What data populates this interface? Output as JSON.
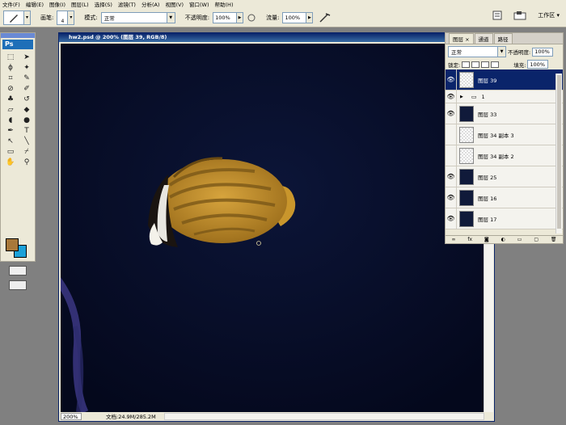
{
  "menubar": {
    "items": [
      "文件(F)",
      "编辑(E)",
      "图像(I)",
      "图层(L)",
      "选择(S)",
      "滤镜(T)",
      "分析(A)",
      "视图(V)",
      "窗口(W)",
      "帮助(H)"
    ]
  },
  "options": {
    "brush_label": "画笔:",
    "brush_size": "4",
    "mode_label": "模式:",
    "mode_value": "正常",
    "opacity_label": "不透明度:",
    "opacity_value": "100%",
    "flow_label": "流量:",
    "flow_value": "100%",
    "workspace": "工作区 ▾"
  },
  "toolbox": {
    "logo": "Ps"
  },
  "document": {
    "title": "hw2.psd @ 200% (图层 39, RGB/8)",
    "zoom": "200%",
    "doc_info": "文档:24.9M/285.2M"
  },
  "layers_panel": {
    "tabs": [
      "图层 ×",
      "通道",
      "路径"
    ],
    "blend_mode": "正常",
    "opacity_label": "不透明度:",
    "opacity_value": "100%",
    "lock_label": "锁定:",
    "fill_label": "填充:",
    "fill_value": "100%",
    "layers": [
      {
        "name": "图层 39",
        "visible": true,
        "selected": true,
        "thumb": "t"
      },
      {
        "name": "1",
        "visible": true,
        "group": true
      },
      {
        "name": "图层 33",
        "visible": true,
        "thumb": "d"
      },
      {
        "name": "图层 34 副本 3",
        "visible": false,
        "thumb": "t"
      },
      {
        "name": "图层 34 副本 2",
        "visible": false,
        "thumb": "t"
      },
      {
        "name": "图层 25",
        "visible": true,
        "thumb": "d"
      },
      {
        "name": "图层 16",
        "visible": true,
        "thumb": "d"
      },
      {
        "name": "图层 17",
        "visible": true,
        "thumb": "d"
      }
    ]
  }
}
